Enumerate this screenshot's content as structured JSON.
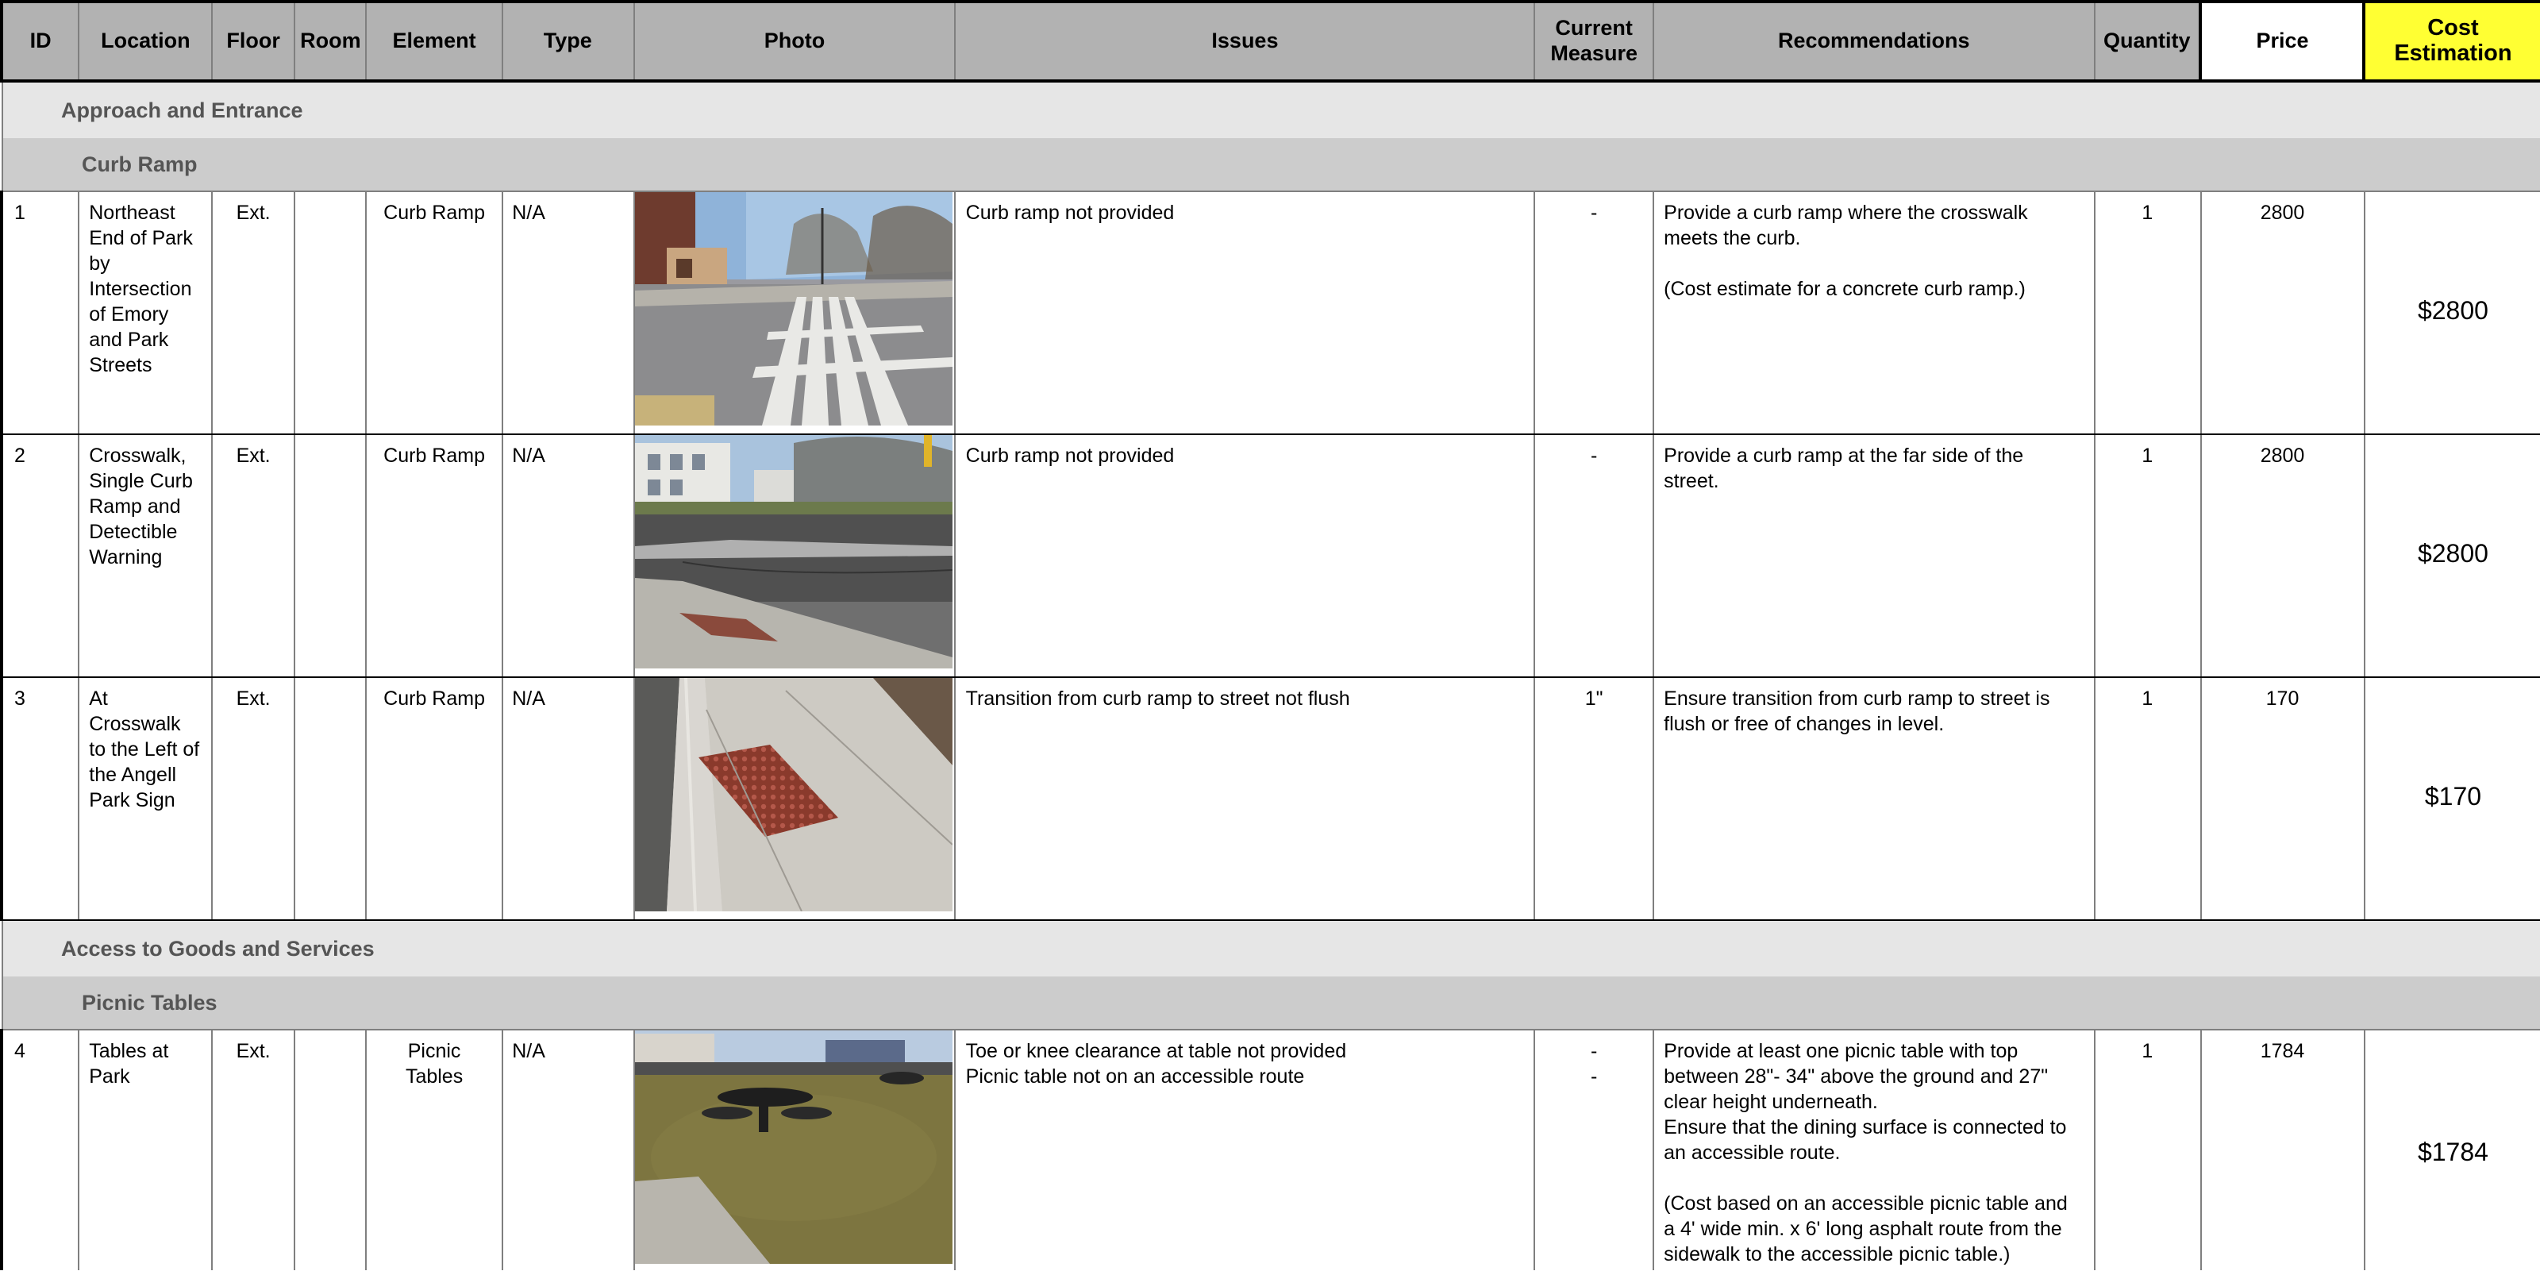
{
  "columns": {
    "id": "ID",
    "location": "Location",
    "floor": "Floor",
    "room": "Room",
    "element": "Element",
    "type": "Type",
    "photo": "Photo",
    "issues": "Issues",
    "current_measure": "Current\nMeasure",
    "recommendations": "Recommendations",
    "quantity": "Quantity",
    "price": "Price",
    "cost_estimation": "Cost\nEstimation"
  },
  "sections": [
    {
      "title": "Approach and Entrance",
      "subsection": "Curb Ramp",
      "rows": [
        {
          "id": "1",
          "location": "Northeast End of Park by Intersection of Emory and Park Streets",
          "floor": "Ext.",
          "room": "",
          "element": "Curb Ramp",
          "type": "N/A",
          "photo": "crosswalk-photo",
          "issues": [
            "Curb ramp not provided"
          ],
          "current_measure": [
            "-"
          ],
          "recommendations": "Provide a curb ramp where the crosswalk meets the curb.\n\n(Cost estimate for a concrete curb ramp.)",
          "quantity": "1",
          "price": "2800",
          "cost": "$2800"
        },
        {
          "id": "2",
          "location": "Crosswalk, Single Curb Ramp and Detectible Warning",
          "floor": "Ext.",
          "room": "",
          "element": "Curb Ramp",
          "type": "N/A",
          "photo": "street-curb-photo",
          "issues": [
            "Curb ramp not provided"
          ],
          "current_measure": [
            "-"
          ],
          "recommendations": "Provide a curb ramp at the far side of the street.",
          "quantity": "1",
          "price": "2800",
          "cost": "$2800"
        },
        {
          "id": "3",
          "location": "At Crosswalk to the Left of the Angell Park Sign",
          "floor": "Ext.",
          "room": "",
          "element": "Curb Ramp",
          "type": "N/A",
          "photo": "detectable-warning-photo",
          "issues": [
            "Transition from curb ramp to street not flush"
          ],
          "current_measure": [
            "1\""
          ],
          "recommendations": "Ensure transition from curb ramp to street is flush or free of changes in level.",
          "quantity": "1",
          "price": "170",
          "cost": "$170"
        }
      ]
    },
    {
      "title": "Access to Goods and Services",
      "subsection": "Picnic Tables",
      "rows": [
        {
          "id": "4",
          "location": "Tables at Park",
          "floor": "Ext.",
          "room": "",
          "element": "Picnic Tables",
          "type": "N/A",
          "photo": "picnic-table-photo",
          "issues": [
            "Toe or knee clearance at table not provided",
            "Picnic table not on an accessible route"
          ],
          "current_measure": [
            "-",
            "-"
          ],
          "recommendations": "Provide at least one picnic table with top between 28\"- 34\" above the ground and 27\" clear height underneath.\nEnsure that the dining surface is connected to an accessible route.\n\n(Cost based on an accessible picnic table and a 4' wide min. x 6' long asphalt route from the sidewalk to the accessible picnic table.)",
          "quantity": "1",
          "price": "1784",
          "cost": "$1784"
        }
      ]
    }
  ],
  "colors": {
    "header_bg": "#b2b2b2",
    "cost_header_bg": "#ffff33",
    "section_bg": "#e6e6e6",
    "subsection_bg": "#cccccc"
  }
}
